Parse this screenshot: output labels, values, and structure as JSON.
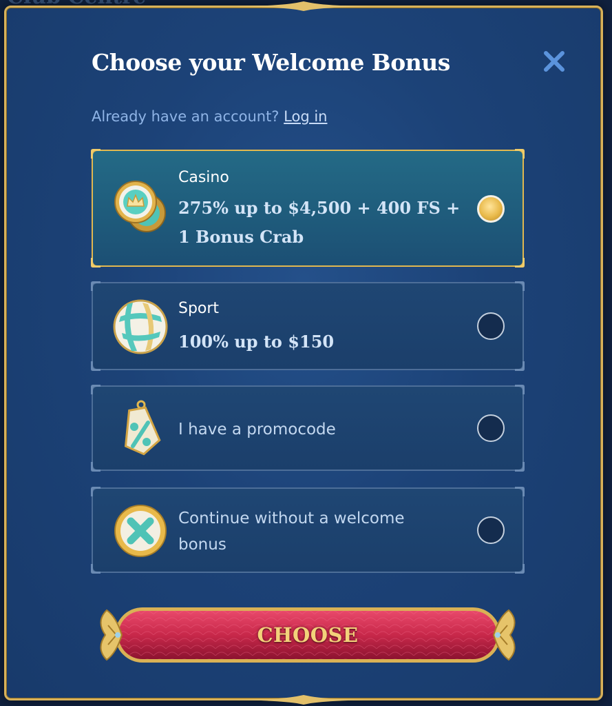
{
  "backdrop": {
    "title": "Club Centre"
  },
  "modal": {
    "title": "Choose your Welcome Bonus",
    "close_icon": "close-icon",
    "login": {
      "prompt": "Already have an account?",
      "link": "Log in"
    }
  },
  "options": [
    {
      "id": "casino",
      "label": "Casino",
      "value_line1": "275% up to $4,500 + 400 FS +",
      "value_line2": "1 Bonus Crab",
      "icon": "casino-chips-icon",
      "selected": true
    },
    {
      "id": "sport",
      "label": "Sport",
      "value": "100% up to $150",
      "icon": "volleyball-icon",
      "selected": false
    },
    {
      "id": "promocode",
      "text": "I have a promocode",
      "icon": "percent-tag-icon",
      "selected": false
    },
    {
      "id": "no-bonus",
      "text_line1": "Continue without a welcome",
      "text_line2": "bonus",
      "icon": "no-bonus-x-icon",
      "selected": false
    }
  ],
  "choose_button": {
    "label": "CHOOSE"
  },
  "colors": {
    "gold": "#d8b25a",
    "modal_bg": "#1c4277",
    "selected_bg": "#1f5c7c",
    "button_red": "#c8284a",
    "title": "#ffffff",
    "link": "#8fb4e6"
  }
}
